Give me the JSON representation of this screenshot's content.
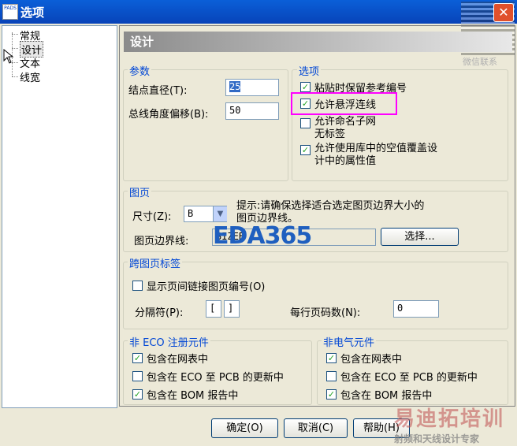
{
  "window": {
    "title": "选项",
    "app_icon": "PADS",
    "close": "✕"
  },
  "tree": {
    "items": [
      "常规",
      "设计",
      "文本",
      "线宽"
    ],
    "selected": 1
  },
  "header": {
    "title": "设计"
  },
  "params": {
    "title": "参数",
    "node_diameter_label": "结点直径(T):",
    "node_diameter_value": "25",
    "bus_angle_label": "总线角度偏移(B):",
    "bus_angle_value": "50"
  },
  "options": {
    "title": "选项",
    "items": [
      {
        "label": "粘贴时保留参考编号",
        "checked": true
      },
      {
        "label": "允许悬浮连线",
        "checked": true
      },
      {
        "label": "允许命名子网无标签",
        "line1": "允许命名子网",
        "line2": "无标签",
        "checked": false
      },
      {
        "label": "允许使用库中的空值覆盖设计中的属性值",
        "line1": "允许使用库中的空值覆盖设",
        "line2": "计中的属性值",
        "checked": true
      }
    ]
  },
  "sheet": {
    "title": "图页",
    "size_label": "尺寸(Z):",
    "size_value": "B",
    "tip_line1": "提示:请确保选择适合选定图页边界大小的",
    "tip_line2": "图页边界线。",
    "border_label": "图页边界线:",
    "border_value": "SIZEB",
    "select_button": "选择..."
  },
  "offpage": {
    "title": "跨图页标签",
    "show_label": "显示页间链接图页编号(O)",
    "show_checked": false,
    "separator_label": "分隔符(P):",
    "sep_left": "[",
    "sep_right": "]",
    "per_line_label": "每行页码数(N):",
    "per_line_value": "0"
  },
  "non_eco": {
    "title": "非 ECO 注册元件",
    "items": [
      {
        "label": "包含在网表中",
        "checked": true
      },
      {
        "label": "包含在 ECO 至 PCB 的更新中",
        "checked": false
      },
      {
        "label": "包含在 BOM 报告中",
        "checked": true
      }
    ]
  },
  "non_elec": {
    "title": "非电气元件",
    "items": [
      {
        "label": "包含在网表中",
        "checked": true
      },
      {
        "label": "包含在 ECO 至 PCB 的更新中",
        "checked": false
      },
      {
        "label": "包含在 BOM 报告中",
        "checked": true
      }
    ]
  },
  "buttons": {
    "ok": "确定(O)",
    "cancel": "取消(C)",
    "help": "帮助(H)"
  },
  "watermarks": {
    "eda": "EDA365",
    "wechat": "微信联系",
    "brand": "易迪拓培训",
    "slogan": "射频和天线设计专家"
  }
}
